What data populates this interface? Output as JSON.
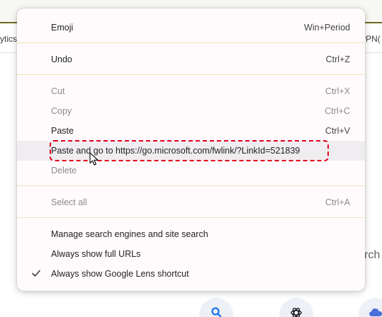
{
  "bookmarks": {
    "left_fragment": "ytics",
    "right_fragment": "yPN("
  },
  "page": {
    "search_fragment": "rch"
  },
  "shortcuts": [
    {
      "icon": "search-icon"
    },
    {
      "icon": "openai-icon"
    },
    {
      "icon": "cloud-icon"
    }
  ],
  "context_menu": {
    "items": [
      {
        "label": "Emoji",
        "shortcut": "Win+Period",
        "enabled": true
      },
      {
        "label": "Undo",
        "shortcut": "Ctrl+Z",
        "enabled": true
      },
      {
        "label": "Cut",
        "shortcut": "Ctrl+X",
        "enabled": false
      },
      {
        "label": "Copy",
        "shortcut": "Ctrl+C",
        "enabled": false
      },
      {
        "label": "Paste",
        "shortcut": "Ctrl+V",
        "enabled": true
      },
      {
        "label": "Paste and go to https://go.microsoft.com/fwlink/?LinkId=521839",
        "shortcut": "",
        "enabled": true,
        "hovered": true
      },
      {
        "label": "Delete",
        "shortcut": "",
        "enabled": false
      },
      {
        "label": "Select all",
        "shortcut": "Ctrl+A",
        "enabled": false
      },
      {
        "label": "Manage search engines and site search",
        "shortcut": "",
        "enabled": true
      },
      {
        "label": "Always show full URLs",
        "shortcut": "",
        "enabled": true
      },
      {
        "label": "Always show Google Lens shortcut",
        "shortcut": "",
        "enabled": true,
        "checked": true
      }
    ]
  },
  "colors": {
    "highlight_border": "#e0001a",
    "separator": "#efe2b6",
    "menu_background": "#fffbfd",
    "top_bar_border": "#6e6a20"
  }
}
